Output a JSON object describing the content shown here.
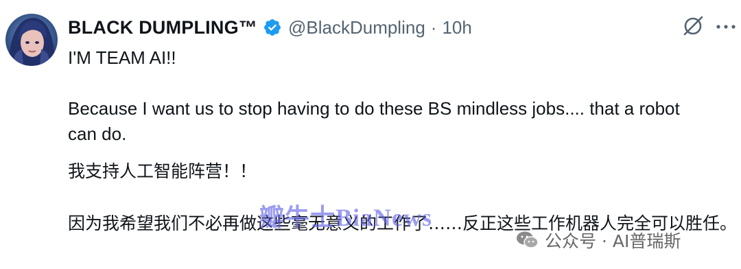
{
  "tweet": {
    "author": {
      "display_name": "BLACK DUMPLING™",
      "handle": "@BlackDumpling",
      "separator": "·",
      "timestamp": "10h",
      "verified_icon": "verified-badge-icon"
    },
    "icons": {
      "grok": "grok-icon",
      "more": "more-options-icon"
    },
    "body": {
      "para1": "I'M TEAM AI!!",
      "para2": "Because I want us to stop having to do these BS mindless jobs.... that a robot can do.",
      "para3": "我支持人工智能阵营！！",
      "para4": "因为我希望我们不必再做这些毫无意义的工作了……反正这些工作机器人完全可以胜任。"
    }
  },
  "watermarks": {
    "overlay_text": "瓣牛士BiaNews",
    "wechat_text": "公众号 · AI普瑞斯"
  },
  "colors": {
    "text_primary": "#0f1419",
    "text_secondary": "#536471",
    "verified_blue": "#1d9bf0",
    "watermark_purple": "#6060e6"
  }
}
